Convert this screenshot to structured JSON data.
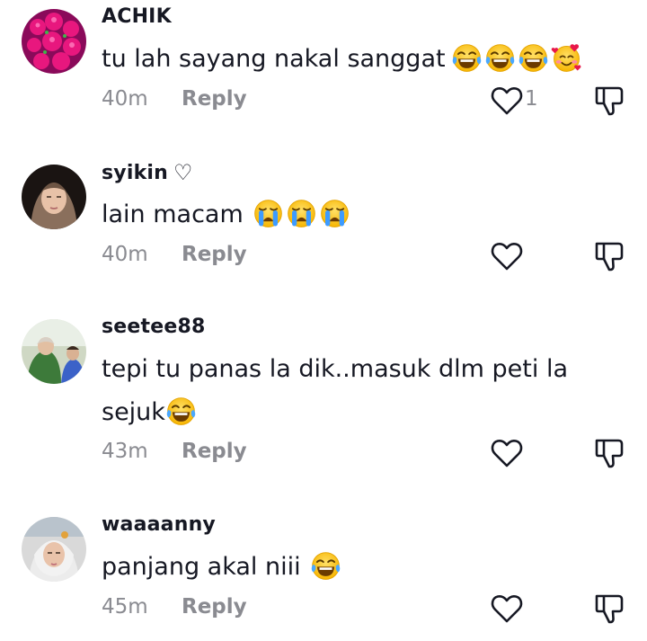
{
  "comments": [
    {
      "username": "ACHIK",
      "text": "tu lah sayang nakal sanggat",
      "emojis": [
        "face-with-tears-of-joy",
        "face-with-tears-of-joy",
        "face-with-tears-of-joy",
        "smiling-face-with-hearts"
      ],
      "time": "40m",
      "reply": "Reply",
      "like_count": "1"
    },
    {
      "username": "syikin",
      "username_suffix": "♡",
      "text": "lain macam",
      "emojis": [
        "loudly-crying-face",
        "loudly-crying-face",
        "loudly-crying-face"
      ],
      "time": "40m",
      "reply": "Reply"
    },
    {
      "username": "seetee88",
      "text_line1": "tepi tu panas la dik..masuk dlm peti la",
      "text_line2": "sejuk",
      "emojis": [
        "face-with-tears-of-joy"
      ],
      "time": "43m",
      "reply": "Reply"
    },
    {
      "username": "waaaanny",
      "text": "panjang akal niii",
      "emojis": [
        "face-with-tears-of-joy"
      ],
      "time": "45m",
      "reply": "Reply"
    }
  ],
  "icons": {
    "like": "heart-outline-icon",
    "dislike": "thumbs-down-outline-icon"
  },
  "colors": {
    "text": "#161823",
    "secondary": "#8a8b91"
  }
}
